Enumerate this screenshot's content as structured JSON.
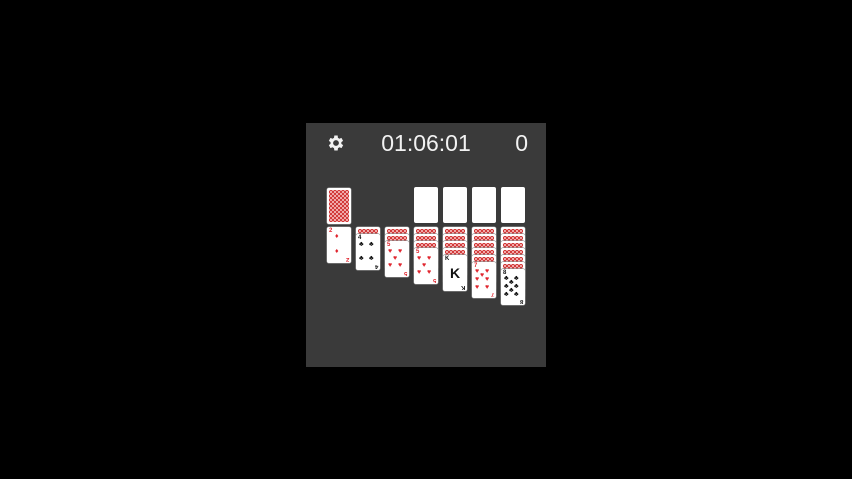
{
  "header": {
    "settings_icon": "gear-icon",
    "timer": "01:06:01",
    "score": "0"
  },
  "colors": {
    "background": "#000000",
    "board": "#3a3a3a",
    "card_back": "#d23a3a",
    "red_suit": "#e0262f"
  },
  "stock": {
    "face_down": true
  },
  "foundations": [
    {
      "empty": true
    },
    {
      "empty": true
    },
    {
      "empty": true
    },
    {
      "empty": true
    }
  ],
  "tableau": [
    {
      "hidden": 0,
      "top": {
        "rank": "2",
        "suit": "♦",
        "color": "red"
      }
    },
    {
      "hidden": 1,
      "top": {
        "rank": "4",
        "suit": "♣",
        "color": "black"
      }
    },
    {
      "hidden": 2,
      "top": {
        "rank": "5",
        "suit": "♥",
        "color": "red"
      }
    },
    {
      "hidden": 3,
      "top": {
        "rank": "5",
        "suit": "♥",
        "color": "red"
      }
    },
    {
      "hidden": 4,
      "top": {
        "rank": "K",
        "suit": "♠",
        "color": "black"
      }
    },
    {
      "hidden": 5,
      "top": {
        "rank": "7",
        "suit": "♥",
        "color": "red"
      }
    },
    {
      "hidden": 6,
      "top": {
        "rank": "8",
        "suit": "♣",
        "color": "black"
      }
    }
  ]
}
